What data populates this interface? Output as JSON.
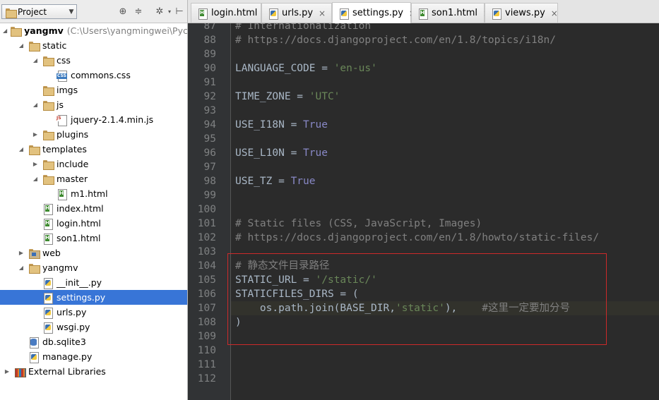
{
  "project_panel": {
    "selector_label": "Project",
    "tree": [
      {
        "label": "yangmv",
        "path": "(C:\\Users\\yangmingwei\\Pycha",
        "icon": "folder",
        "arrow": "expanded",
        "depth": 0,
        "bold": true
      },
      {
        "label": "static",
        "icon": "folder",
        "arrow": "expanded",
        "depth": 1
      },
      {
        "label": "css",
        "icon": "folder",
        "arrow": "expanded",
        "depth": 2
      },
      {
        "label": "commons.css",
        "icon": "css-file",
        "arrow": "none",
        "depth": 3
      },
      {
        "label": "imgs",
        "icon": "folder",
        "arrow": "none",
        "depth": 2
      },
      {
        "label": "js",
        "icon": "folder",
        "arrow": "expanded",
        "depth": 2
      },
      {
        "label": "jquery-2.1.4.min.js",
        "icon": "js-file",
        "arrow": "none",
        "depth": 3
      },
      {
        "label": "plugins",
        "icon": "folder",
        "arrow": "collapsed",
        "depth": 2
      },
      {
        "label": "templates",
        "icon": "folder",
        "arrow": "expanded",
        "depth": 1
      },
      {
        "label": "include",
        "icon": "folder",
        "arrow": "collapsed",
        "depth": 2
      },
      {
        "label": "master",
        "icon": "folder",
        "arrow": "expanded",
        "depth": 2
      },
      {
        "label": "m1.html",
        "icon": "html-file",
        "arrow": "none",
        "depth": 3
      },
      {
        "label": "index.html",
        "icon": "html-file",
        "arrow": "none",
        "depth": 2
      },
      {
        "label": "login.html",
        "icon": "html-file",
        "arrow": "none",
        "depth": 2
      },
      {
        "label": "son1.html",
        "icon": "html-file",
        "arrow": "none",
        "depth": 2
      },
      {
        "label": "web",
        "icon": "module-folder",
        "arrow": "collapsed",
        "depth": 1
      },
      {
        "label": "yangmv",
        "icon": "folder",
        "arrow": "expanded",
        "depth": 1
      },
      {
        "label": "__init__.py",
        "icon": "python-file",
        "arrow": "none",
        "depth": 2
      },
      {
        "label": "settings.py",
        "icon": "python-file",
        "arrow": "none",
        "depth": 2,
        "selected": true
      },
      {
        "label": "urls.py",
        "icon": "python-file",
        "arrow": "none",
        "depth": 2
      },
      {
        "label": "wsgi.py",
        "icon": "python-file",
        "arrow": "none",
        "depth": 2
      },
      {
        "label": "db.sqlite3",
        "icon": "database-file",
        "arrow": "none",
        "depth": 1
      },
      {
        "label": "manage.py",
        "icon": "python-file",
        "arrow": "none",
        "depth": 1
      },
      {
        "label": "External Libraries",
        "icon": "libraries",
        "arrow": "collapsed",
        "depth": 0
      }
    ]
  },
  "tabs": [
    {
      "label": "login.html",
      "icon": "html-file"
    },
    {
      "label": "urls.py",
      "icon": "python-file"
    },
    {
      "label": "settings.py",
      "icon": "python-file",
      "active": true
    },
    {
      "label": "son1.html",
      "icon": "html-file"
    },
    {
      "label": "views.py",
      "icon": "python-file"
    }
  ],
  "editor": {
    "lines": [
      {
        "n": "87",
        "tokens": [
          [
            "comment",
            "# Internationalization"
          ]
        ]
      },
      {
        "n": "88",
        "tokens": [
          [
            "comment",
            "# https://docs.djangoproject.com/en/1.8/topics/i18n/"
          ]
        ]
      },
      {
        "n": "89",
        "tokens": []
      },
      {
        "n": "90",
        "tokens": [
          [
            "plain",
            "LANGUAGE_CODE = "
          ],
          [
            "string",
            "'en-us'"
          ]
        ]
      },
      {
        "n": "91",
        "tokens": []
      },
      {
        "n": "92",
        "tokens": [
          [
            "plain",
            "TIME_ZONE = "
          ],
          [
            "string",
            "'UTC'"
          ]
        ]
      },
      {
        "n": "93",
        "tokens": []
      },
      {
        "n": "94",
        "tokens": [
          [
            "plain",
            "USE_I18N = "
          ],
          [
            "kw",
            "True"
          ]
        ]
      },
      {
        "n": "95",
        "tokens": []
      },
      {
        "n": "96",
        "tokens": [
          [
            "plain",
            "USE_L10N = "
          ],
          [
            "kw",
            "True"
          ]
        ]
      },
      {
        "n": "97",
        "tokens": []
      },
      {
        "n": "98",
        "tokens": [
          [
            "plain",
            "USE_TZ = "
          ],
          [
            "kw",
            "True"
          ]
        ]
      },
      {
        "n": "99",
        "tokens": []
      },
      {
        "n": "100",
        "tokens": []
      },
      {
        "n": "101",
        "tokens": [
          [
            "comment",
            "# Static files (CSS, JavaScript, Images)"
          ]
        ]
      },
      {
        "n": "102",
        "tokens": [
          [
            "comment",
            "# https://docs.djangoproject.com/en/1.8/howto/static-files/"
          ]
        ]
      },
      {
        "n": "103",
        "tokens": []
      },
      {
        "n": "104",
        "tokens": [
          [
            "comment",
            "# 静态文件目录路径"
          ]
        ]
      },
      {
        "n": "105",
        "tokens": [
          [
            "plain",
            "STATIC_URL = "
          ],
          [
            "string",
            "'/static/'"
          ]
        ]
      },
      {
        "n": "106",
        "tokens": [
          [
            "plain",
            "STATICFILES_DIRS = ("
          ]
        ]
      },
      {
        "n": "107",
        "current": true,
        "tokens": [
          [
            "plain",
            "    os.path.join(BASE_DIR,"
          ],
          [
            "string",
            "'static'"
          ],
          [
            "plain",
            "),    "
          ],
          [
            "comment",
            "#这里一定要加分号"
          ]
        ]
      },
      {
        "n": "108",
        "tokens": [
          [
            "plain",
            ")"
          ]
        ]
      },
      {
        "n": "109",
        "tokens": []
      },
      {
        "n": "110",
        "tokens": []
      },
      {
        "n": "111",
        "tokens": []
      },
      {
        "n": "112",
        "tokens": []
      }
    ]
  },
  "colors": {
    "editor_bg": "#2b2b2b",
    "comment": "#808080",
    "string": "#6a8759",
    "keyword": "#8888c6",
    "selection": "#3875d7",
    "annotation_box": "#cc2a2a"
  }
}
